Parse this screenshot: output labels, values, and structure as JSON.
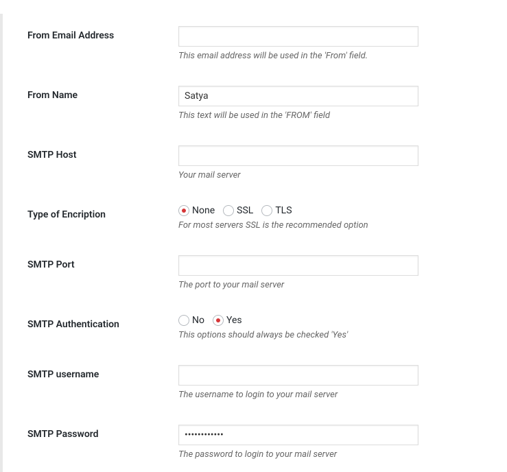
{
  "fields": {
    "from_email": {
      "label": "From Email Address",
      "value": "",
      "description": "This email address will be used in the 'From' field."
    },
    "from_name": {
      "label": "From Name",
      "value": "Satya",
      "description": "This text will be used in the 'FROM' field"
    },
    "smtp_host": {
      "label": "SMTP Host",
      "value": "",
      "description": "Your mail server"
    },
    "encryption": {
      "label": "Type of Encription",
      "options": {
        "none": "None",
        "ssl": "SSL",
        "tls": "TLS"
      },
      "selected": "none",
      "description": "For most servers SSL is the recommended option"
    },
    "smtp_port": {
      "label": "SMTP Port",
      "value": "",
      "description": "The port to your mail server"
    },
    "smtp_auth": {
      "label": "SMTP Authentication",
      "options": {
        "no": "No",
        "yes": "Yes"
      },
      "selected": "yes",
      "description": "This options should always be checked 'Yes'"
    },
    "smtp_username": {
      "label": "SMTP username",
      "value": "",
      "description": "The username to login to your mail server"
    },
    "smtp_password": {
      "label": "SMTP Password",
      "value": "••••••••••••",
      "description": "The password to login to your mail server"
    }
  }
}
